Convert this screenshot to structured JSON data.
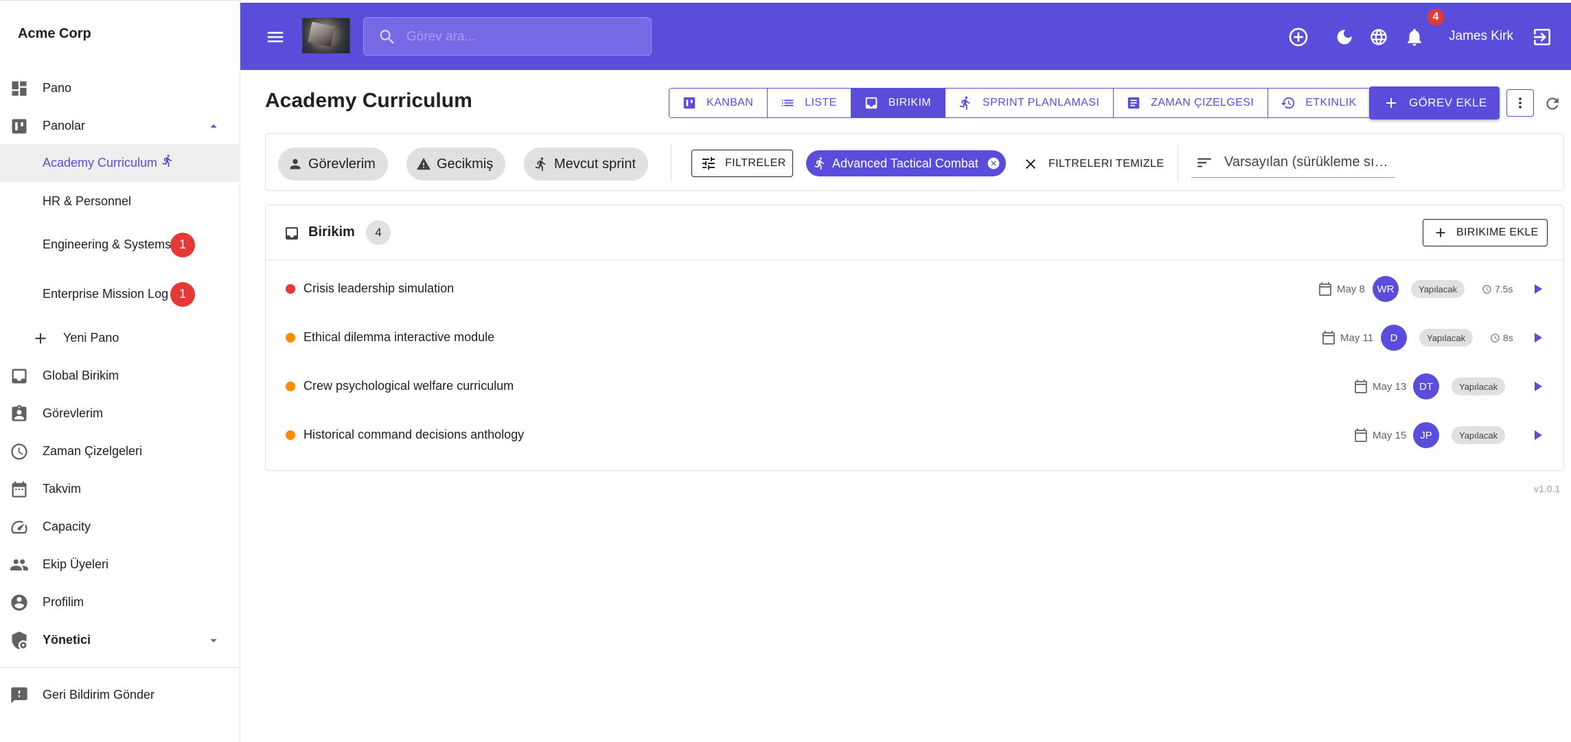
{
  "app": {
    "name": "Acme Corp"
  },
  "sidebar": {
    "items": [
      {
        "label": "Pano",
        "icon": "dashboard-icon"
      },
      {
        "label": "Panolar",
        "icon": "boards-icon"
      },
      {
        "label": "Academy Curriculum",
        "icon": "sprint-run-icon"
      },
      {
        "label": "HR & Personnel"
      },
      {
        "label": "Engineering & Systems",
        "badge": "1"
      },
      {
        "label": "Enterprise Mission Log",
        "badge": "1"
      },
      {
        "label": "Yeni Pano",
        "icon": "plus-icon"
      },
      {
        "label": "Global Birikim",
        "icon": "inbox-icon"
      },
      {
        "label": "Görevlerim",
        "icon": "clipboard-user-icon"
      },
      {
        "label": "Zaman Çizelgeleri",
        "icon": "clock-icon"
      },
      {
        "label": "Takvim",
        "icon": "calendar-icon"
      },
      {
        "label": "Capacity",
        "icon": "speedometer-icon"
      },
      {
        "label": "Ekip Üyeleri",
        "icon": "people-icon"
      },
      {
        "label": "Profilim",
        "icon": "account-circle-icon"
      },
      {
        "label": "Yönetici",
        "icon": "admin-shield-icon"
      },
      {
        "label": "Geri Bildirim Gönder",
        "icon": "feedback-icon"
      }
    ]
  },
  "topbar": {
    "search_placeholder": "Görev ara...",
    "notifications_count": "4",
    "user_name": "James Kirk"
  },
  "page": {
    "title": "Academy Curriculum",
    "tabs": [
      {
        "label": "KANBAN",
        "icon": "kanban-icon"
      },
      {
        "label": "LISTE",
        "icon": "list-icon"
      },
      {
        "label": "BIRIKIM",
        "icon": "inbox-icon",
        "active": true
      },
      {
        "label": "SPRINT PLANLAMASI",
        "icon": "sprint-run-icon"
      },
      {
        "label": "ZAMAN ÇIZELGESI",
        "icon": "timesheet-icon"
      },
      {
        "label": "ETKINLIK",
        "icon": "history-icon"
      }
    ],
    "add_task_label": "GÖREV EKLE"
  },
  "filters": {
    "quick": [
      "Görevlerim",
      "Gecikmiş",
      "Mevcut sprint"
    ],
    "filters_label": "FILTRELER",
    "active_filter": "Advanced Tactical Combat",
    "clear_label": "FILTRELERI TEMIZLE",
    "sort_label": "Varsayılan (sürükleme sıralaması)"
  },
  "backlog": {
    "title": "Birikim",
    "count": "4",
    "add_label": "BIRIKIME EKLE",
    "rows": [
      {
        "title": "Crisis leadership simulation",
        "priority_color": "#e53935",
        "date": "May 8",
        "assignee": "WR",
        "status": "Yapılacak",
        "duration": "7.5s"
      },
      {
        "title": "Ethical dilemma interactive module",
        "priority_color": "#fb8c00",
        "date": "May 11",
        "assignee": "D",
        "status": "Yapılacak",
        "duration": "8s"
      },
      {
        "title": "Crew psychological welfare curriculum",
        "priority_color": "#fb8c00",
        "date": "May 13",
        "assignee": "DT",
        "status": "Yapılacak"
      },
      {
        "title": "Historical command decisions anthology",
        "priority_color": "#fb8c00",
        "date": "May 15",
        "assignee": "JP",
        "status": "Yapılacak"
      }
    ]
  },
  "version": "v1.0.1",
  "colors": {
    "primary": "#5b4ddb",
    "badge": "#e53935",
    "high_priority": "#e53935",
    "medium_priority": "#fb8c00"
  }
}
